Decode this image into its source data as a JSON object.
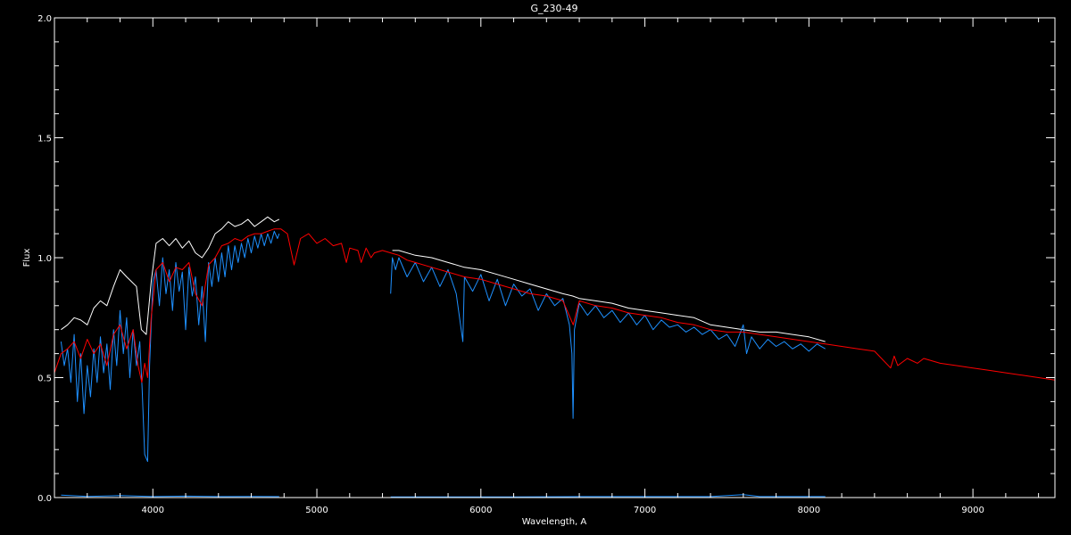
{
  "chart_data": {
    "type": "line",
    "title": "G_230-49",
    "xlabel": "Wavelength, A",
    "ylabel": "Flux",
    "xlim": [
      3400,
      9500
    ],
    "ylim": [
      0.0,
      2.0
    ],
    "x_ticks": [
      {
        "value": 4000,
        "label": "4000"
      },
      {
        "value": 5000,
        "label": "5000"
      },
      {
        "value": 6000,
        "label": "6000"
      },
      {
        "value": 7000,
        "label": "7000"
      },
      {
        "value": 8000,
        "label": "8000"
      },
      {
        "value": 9000,
        "label": "9000"
      }
    ],
    "y_ticks": [
      {
        "value": 0.0,
        "label": "0.0"
      },
      {
        "value": 0.5,
        "label": "0.5"
      },
      {
        "value": 1.0,
        "label": "1.0"
      },
      {
        "value": 1.5,
        "label": "1.5"
      },
      {
        "value": 2.0,
        "label": "2.0"
      }
    ],
    "grid": false,
    "colors": {
      "background": "#000000",
      "axes": "#ffffff",
      "model": "#ff0000",
      "observed": "#1e90ff",
      "observed_upper": "#ffffff"
    },
    "series": [
      {
        "key": "observed_upper",
        "color": "#ffffff",
        "x": [
          3440,
          3480,
          3520,
          3560,
          3600,
          3640,
          3680,
          3720,
          3760,
          3800,
          3840,
          3870,
          3900,
          3930,
          3960,
          3990,
          4020,
          4060,
          4100,
          4140,
          4180,
          4220,
          4260,
          4300,
          4340,
          4380,
          4420,
          4460,
          4500,
          4540,
          4580,
          4620,
          4660,
          4700,
          4740,
          4770
        ],
        "y": [
          0.7,
          0.72,
          0.75,
          0.74,
          0.72,
          0.79,
          0.82,
          0.8,
          0.88,
          0.95,
          0.92,
          0.9,
          0.88,
          0.7,
          0.68,
          0.9,
          1.06,
          1.08,
          1.05,
          1.08,
          1.04,
          1.07,
          1.02,
          1.0,
          1.04,
          1.1,
          1.12,
          1.15,
          1.13,
          1.14,
          1.16,
          1.13,
          1.15,
          1.17,
          1.15,
          1.16
        ]
      },
      {
        "key": "observed_upper_2",
        "color": "#ffffff",
        "x": [
          5460,
          5500,
          5600,
          5700,
          5800,
          5900,
          6000,
          6100,
          6200,
          6300,
          6400,
          6500,
          6560,
          6600,
          6700,
          6800,
          6900,
          7000,
          7100,
          7200,
          7300,
          7400,
          7500,
          7600,
          7700,
          7800,
          7900,
          8000,
          8100
        ],
        "y": [
          1.03,
          1.03,
          1.01,
          1.0,
          0.98,
          0.96,
          0.95,
          0.93,
          0.91,
          0.89,
          0.87,
          0.85,
          0.84,
          0.83,
          0.82,
          0.81,
          0.79,
          0.78,
          0.77,
          0.76,
          0.75,
          0.72,
          0.71,
          0.7,
          0.69,
          0.69,
          0.68,
          0.67,
          0.65
        ]
      },
      {
        "key": "observed",
        "color": "#1e90ff",
        "x": [
          3440,
          3460,
          3480,
          3500,
          3520,
          3540,
          3560,
          3580,
          3600,
          3620,
          3640,
          3660,
          3680,
          3700,
          3720,
          3740,
          3760,
          3780,
          3800,
          3820,
          3840,
          3860,
          3880,
          3900,
          3920,
          3935,
          3950,
          3968,
          3980,
          4000,
          4020,
          4040,
          4060,
          4080,
          4100,
          4120,
          4140,
          4160,
          4180,
          4200,
          4220,
          4240,
          4260,
          4280,
          4300,
          4320,
          4340,
          4360,
          4380,
          4400,
          4420,
          4440,
          4460,
          4480,
          4500,
          4520,
          4540,
          4560,
          4580,
          4600,
          4620,
          4640,
          4660,
          4680,
          4700,
          4720,
          4740,
          4760,
          4770
        ],
        "y": [
          0.65,
          0.55,
          0.62,
          0.48,
          0.68,
          0.4,
          0.6,
          0.35,
          0.55,
          0.42,
          0.62,
          0.48,
          0.67,
          0.52,
          0.64,
          0.45,
          0.7,
          0.55,
          0.78,
          0.6,
          0.75,
          0.5,
          0.7,
          0.55,
          0.65,
          0.45,
          0.18,
          0.15,
          0.55,
          0.9,
          0.95,
          0.8,
          1.0,
          0.85,
          0.95,
          0.78,
          0.98,
          0.86,
          0.94,
          0.7,
          0.96,
          0.84,
          0.92,
          0.72,
          0.88,
          0.65,
          0.98,
          0.88,
          1.0,
          0.9,
          1.02,
          0.92,
          1.05,
          0.95,
          1.05,
          0.98,
          1.06,
          1.0,
          1.08,
          1.02,
          1.09,
          1.04,
          1.1,
          1.05,
          1.1,
          1.06,
          1.11,
          1.08,
          1.1
        ]
      },
      {
        "key": "observed_2",
        "color": "#1e90ff",
        "x": [
          5450,
          5460,
          5480,
          5500,
          5550,
          5600,
          5650,
          5700,
          5750,
          5800,
          5850,
          5890,
          5900,
          5950,
          6000,
          6050,
          6100,
          6150,
          6200,
          6250,
          6300,
          6350,
          6400,
          6450,
          6500,
          6540,
          6555,
          6562,
          6570,
          6600,
          6650,
          6700,
          6750,
          6800,
          6850,
          6900,
          6950,
          7000,
          7050,
          7100,
          7150,
          7200,
          7250,
          7300,
          7350,
          7400,
          7450,
          7500,
          7550,
          7600,
          7620,
          7650,
          7700,
          7750,
          7800,
          7850,
          7900,
          7950,
          8000,
          8050,
          8100
        ],
        "y": [
          0.85,
          1.0,
          0.95,
          1.0,
          0.92,
          0.98,
          0.9,
          0.96,
          0.88,
          0.95,
          0.85,
          0.65,
          0.92,
          0.86,
          0.93,
          0.82,
          0.91,
          0.8,
          0.89,
          0.84,
          0.87,
          0.78,
          0.85,
          0.8,
          0.83,
          0.72,
          0.6,
          0.33,
          0.7,
          0.81,
          0.76,
          0.8,
          0.75,
          0.78,
          0.73,
          0.77,
          0.72,
          0.76,
          0.7,
          0.74,
          0.71,
          0.72,
          0.69,
          0.71,
          0.68,
          0.7,
          0.66,
          0.68,
          0.63,
          0.72,
          0.6,
          0.67,
          0.62,
          0.66,
          0.63,
          0.65,
          0.62,
          0.64,
          0.61,
          0.64,
          0.62
        ]
      },
      {
        "key": "model",
        "color": "#ff0000",
        "x": [
          3400,
          3440,
          3480,
          3520,
          3560,
          3600,
          3640,
          3680,
          3720,
          3760,
          3800,
          3840,
          3880,
          3910,
          3933,
          3950,
          3968,
          3990,
          4020,
          4060,
          4101,
          4140,
          4180,
          4220,
          4260,
          4300,
          4340,
          4380,
          4420,
          4460,
          4500,
          4540,
          4580,
          4620,
          4660,
          4700,
          4740,
          4780,
          4820,
          4861,
          4900,
          4950,
          5000,
          5050,
          5100,
          5150,
          5180,
          5200,
          5250,
          5270,
          5300,
          5330,
          5350,
          5400,
          5450,
          5500,
          5550,
          5600,
          5700,
          5800,
          5900,
          6000,
          6100,
          6200,
          6300,
          6400,
          6500,
          6563,
          6600,
          6700,
          6800,
          6900,
          7000,
          7100,
          7200,
          7300,
          7400,
          7500,
          7600,
          7700,
          7800,
          7900,
          8000,
          8100,
          8200,
          8300,
          8400,
          8498,
          8520,
          8542,
          8600,
          8662,
          8700,
          8800,
          8900,
          9000,
          9100,
          9200,
          9300,
          9400,
          9500
        ],
        "y": [
          0.52,
          0.6,
          0.62,
          0.65,
          0.58,
          0.66,
          0.6,
          0.64,
          0.55,
          0.68,
          0.72,
          0.62,
          0.7,
          0.55,
          0.48,
          0.56,
          0.5,
          0.75,
          0.95,
          0.98,
          0.9,
          0.96,
          0.95,
          0.98,
          0.85,
          0.8,
          0.97,
          1.0,
          1.05,
          1.06,
          1.08,
          1.07,
          1.09,
          1.1,
          1.1,
          1.11,
          1.12,
          1.12,
          1.1,
          0.97,
          1.08,
          1.1,
          1.06,
          1.08,
          1.05,
          1.06,
          0.98,
          1.04,
          1.03,
          0.98,
          1.04,
          1.0,
          1.02,
          1.03,
          1.02,
          1.01,
          0.99,
          0.98,
          0.96,
          0.94,
          0.92,
          0.91,
          0.89,
          0.87,
          0.85,
          0.84,
          0.82,
          0.72,
          0.82,
          0.8,
          0.79,
          0.77,
          0.76,
          0.75,
          0.73,
          0.72,
          0.7,
          0.69,
          0.69,
          0.68,
          0.67,
          0.66,
          0.65,
          0.64,
          0.63,
          0.62,
          0.61,
          0.54,
          0.59,
          0.55,
          0.58,
          0.56,
          0.58,
          0.56,
          0.55,
          0.54,
          0.53,
          0.52,
          0.51,
          0.5,
          0.49
        ]
      },
      {
        "key": "error",
        "color": "#1e90ff",
        "x": [
          3440,
          3600,
          3800,
          4000,
          4200,
          4400,
          4600,
          4770
        ],
        "y": [
          0.01,
          0.005,
          0.008,
          0.004,
          0.006,
          0.004,
          0.005,
          0.004
        ]
      },
      {
        "key": "error_2",
        "color": "#1e90ff",
        "x": [
          5450,
          5800,
          6200,
          6600,
          7000,
          7400,
          7600,
          7650,
          7700,
          8100
        ],
        "y": [
          0.003,
          0.003,
          0.003,
          0.004,
          0.004,
          0.004,
          0.012,
          0.008,
          0.004,
          0.004
        ]
      }
    ]
  }
}
